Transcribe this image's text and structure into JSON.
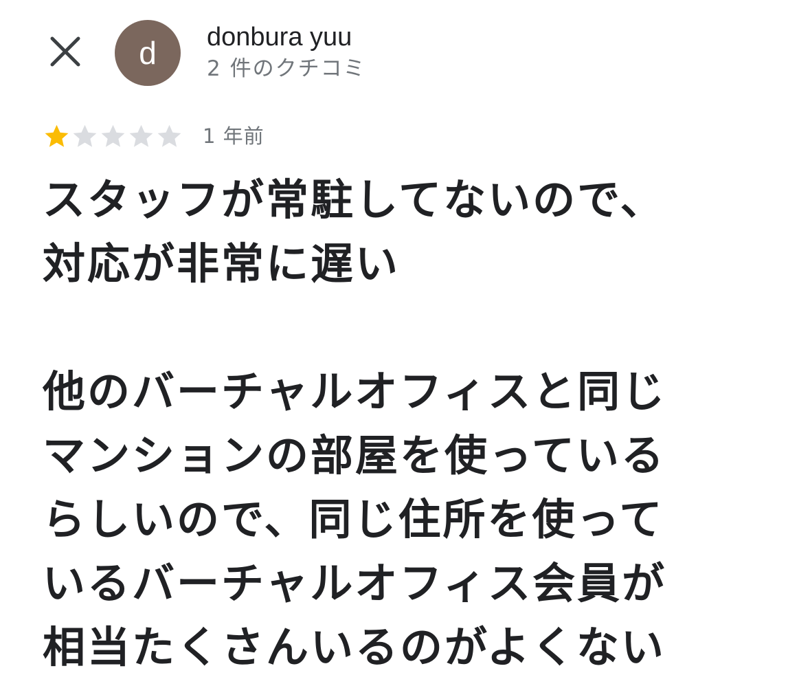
{
  "header": {
    "close_icon": "close-icon",
    "avatar_letter": "d",
    "avatar_color": "#7b675d",
    "reviewer_name": "donbura yuu",
    "review_count": "2 件のクチコミ"
  },
  "review": {
    "rating": 1,
    "max_rating": 5,
    "star_filled_color": "#fbbc04",
    "star_empty_color": "#dadce0",
    "date": "1 年前",
    "text": "スタッフが常駐してないので、\n対応が非常に遅い\n\n他のバーチャルオフィスと同じ\nマンションの部屋を使っている\nらしいので、同じ住所を使って\nいるバーチャルオフィス会員が\n相当たくさんいるのがよくない"
  }
}
